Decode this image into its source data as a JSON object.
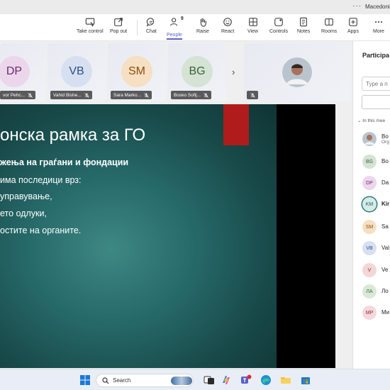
{
  "window": {
    "title": "Macedonia",
    "more_label": "···"
  },
  "toolbar": {
    "take_control": "Take control",
    "pop_out": "Pop out",
    "chat": "Chat",
    "people": "People",
    "people_count": "9",
    "raise": "Raise",
    "react": "React",
    "view": "View",
    "controls": "Controls",
    "notes": "Notes",
    "rooms": "Rooms",
    "apps": "Apps",
    "more": "More"
  },
  "tiles": [
    {
      "initials": "DP",
      "name": "vor Pehc...",
      "bg": "#ecd6ec",
      "fg": "#6a2a6a"
    },
    {
      "initials": "VB",
      "name": "Vahid Bishe...",
      "bg": "#d6e0f0",
      "fg": "#2f4f86"
    },
    {
      "initials": "SM",
      "name": "Sara Marko...",
      "bg": "#f6dfc2",
      "fg": "#8a4d13"
    },
    {
      "initials": "BG",
      "name": "Bosko Sofij...",
      "bg": "#d4e3d4",
      "fg": "#3b5f3b"
    }
  ],
  "slide": {
    "title": "онска рамка за ГО",
    "lines": [
      "жења на граѓани и фондации",
      "има последици врз:",
      "управување,",
      "ето одлуки,",
      "остите на органите."
    ]
  },
  "sidebar": {
    "title": "Participa",
    "search_placeholder": "Type a n",
    "in_meeting": "In this mee",
    "participants": [
      {
        "initials": "",
        "name": "Bo",
        "sub": "Org",
        "bg": "#9aa7b5",
        "fg": "#ffffff",
        "photo": true
      },
      {
        "initials": "BG",
        "name": "Bo",
        "sub": "",
        "bg": "#d4e3d4",
        "fg": "#3b5f3b"
      },
      {
        "initials": "DP",
        "name": "Da",
        "sub": "",
        "bg": "#ecd6ec",
        "fg": "#6a2a6a"
      },
      {
        "initials": "KM",
        "name": "Kir",
        "sub": "",
        "bg": "#d6ecea",
        "fg": "#1f5e5a",
        "ring": true
      },
      {
        "initials": "SM",
        "name": "Sa",
        "sub": "",
        "bg": "#f6dfc2",
        "fg": "#8a4d13"
      },
      {
        "initials": "VB",
        "name": "Val",
        "sub": "",
        "bg": "#d6e0f0",
        "fg": "#2f4f86"
      },
      {
        "initials": "V",
        "name": "Ve",
        "sub": "",
        "bg": "#f3d6d6",
        "fg": "#8a2a2a"
      },
      {
        "initials": "ЛА",
        "name": "Ло",
        "sub": "",
        "bg": "#d8ead6",
        "fg": "#3f6b3a"
      },
      {
        "initials": "MP",
        "name": "Ми",
        "sub": "",
        "bg": "#f4d8dc",
        "fg": "#8a2a3a"
      }
    ]
  },
  "taskbar": {
    "search_label": "Search"
  },
  "colors": {
    "accent": "#5b5fc7",
    "slide_bg": "#276a6a",
    "red_bar": "#b01c1c"
  }
}
